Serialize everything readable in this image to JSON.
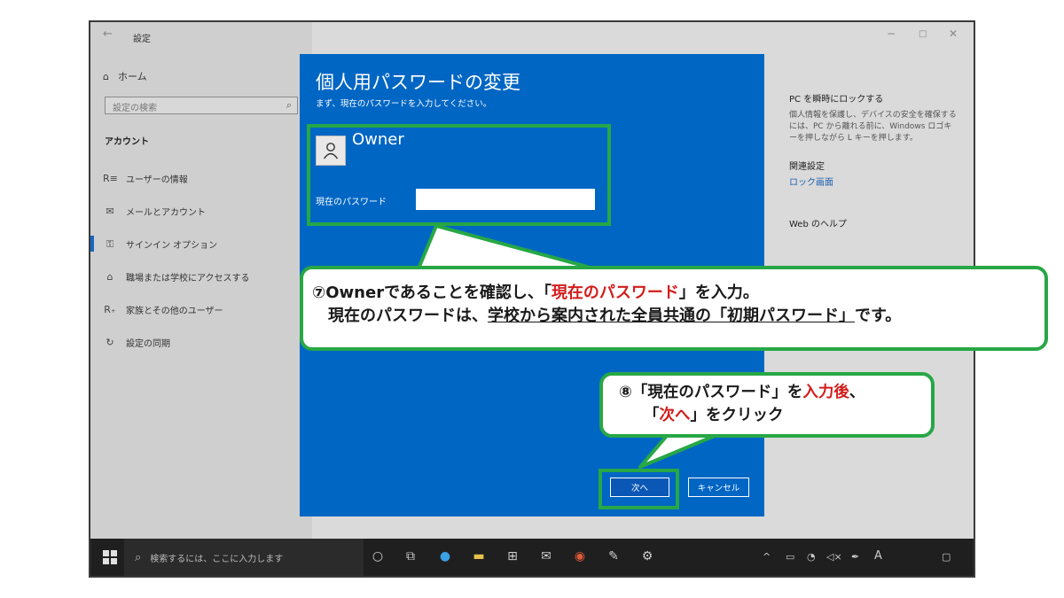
{
  "window": {
    "title": "設定",
    "back": "←",
    "minimize": "−",
    "maximize": "□",
    "close": "✕"
  },
  "sidebar": {
    "home": "ホーム",
    "search_placeholder": "設定の検索",
    "section": "アカウント",
    "items": [
      {
        "icon": "user-info-icon",
        "glyph": "R≡",
        "label": "ユーザーの情報"
      },
      {
        "icon": "mail-icon",
        "glyph": "✉",
        "label": "メールとアカウント"
      },
      {
        "icon": "key-icon",
        "glyph": "⚿",
        "label": "サインイン オプション"
      },
      {
        "icon": "briefcase-icon",
        "glyph": "⌂",
        "label": "職場または学校にアクセスする"
      },
      {
        "icon": "family-icon",
        "glyph": "R₊",
        "label": "家族とその他のユーザー"
      },
      {
        "icon": "sync-icon",
        "glyph": "↻",
        "label": "設定の同期"
      }
    ]
  },
  "right_panel": {
    "lock_title": "PC を瞬時にロックする",
    "lock_desc": "個人情報を保護し、デバイスの安全を確保するには、PC から離れる前に、Windows ロゴキーを押しながら L キーを押します。",
    "related_title": "関連設定",
    "related_link": "ロック画面",
    "help_title": "Web のヘルプ"
  },
  "dialog": {
    "title": "個人用パスワードの変更",
    "subtitle": "まず、現在のパスワードを入力してください。",
    "user": "Owner",
    "password_label": "現在のパスワード",
    "password_value": "",
    "next_button": "次へ",
    "cancel_button": "キャンセル"
  },
  "taskbar": {
    "search_placeholder": "検索するには、ここに入力します",
    "ime": "A"
  },
  "callouts": {
    "c1_line1_prefix": "⑦Ownerであることを確認し、「",
    "c1_line1_red": "現在のパスワード",
    "c1_line1_suffix": "」を入力。",
    "c1_line2_prefix": "　現在のパスワードは、",
    "c1_line2_underline": "学校から案内された全員共通の「初期パスワード」",
    "c1_line2_suffix": "です。",
    "c2_line1_prefix": "⑧「現在のパスワード」を",
    "c2_line1_red": "入力後",
    "c2_line1_suffix": "、",
    "c2_line2_prefix": "「",
    "c2_line2_red": "次へ",
    "c2_line2_suffix": "」をクリック"
  },
  "colors": {
    "accent": "#0066c4",
    "callout_border": "#27a745",
    "emphasis": "#d31c1c"
  }
}
